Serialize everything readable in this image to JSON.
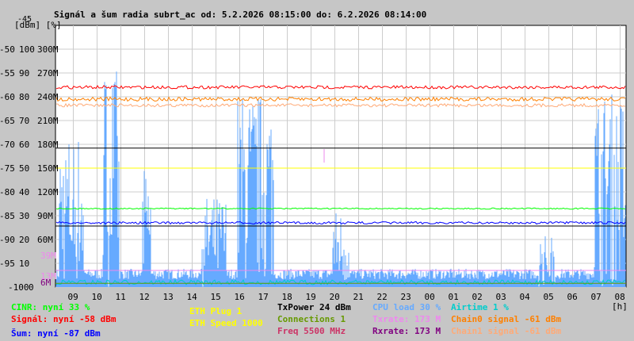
{
  "chart_data": {
    "type": "line",
    "title": "Signál a šum radia subrt_ac od: 5.2.2026 08:15:00 do: 6.2.2026 08:14:00",
    "y_units": "[dBm] [%]",
    "y_top_label": "-45",
    "ylim": [
      -100,
      -45
    ],
    "yticks": [
      {
        "dbm": "-50",
        "pct": "100",
        "rate": "300M"
      },
      {
        "dbm": "-55",
        "pct": "90",
        "rate": "270M"
      },
      {
        "dbm": "-60",
        "pct": "80",
        "rate": "240M"
      },
      {
        "dbm": "-65",
        "pct": "70",
        "rate": "210M"
      },
      {
        "dbm": "-70",
        "pct": "60",
        "rate": "180M"
      },
      {
        "dbm": "-75",
        "pct": "50",
        "rate": "150M"
      },
      {
        "dbm": "-80",
        "pct": "40",
        "rate": "120M"
      },
      {
        "dbm": "-85",
        "pct": "30",
        "rate": "90M"
      },
      {
        "dbm": "-90",
        "pct": "20",
        "rate": "60M"
      },
      {
        "dbm": "-95",
        "pct": "10",
        "rate": ""
      },
      {
        "dbm": "-100",
        "pct": "0",
        "rate": ""
      }
    ],
    "extra_labels": {
      "a": "39M",
      "b": "13M",
      "c": "6M"
    },
    "xticks": [
      "09",
      "10",
      "11",
      "12",
      "13",
      "14",
      "15",
      "16",
      "17",
      "18",
      "19",
      "20",
      "21",
      "22",
      "23",
      "00",
      "01",
      "02",
      "03",
      "04",
      "05",
      "06",
      "07",
      "08"
    ],
    "x_unit": "[h]",
    "series": [
      {
        "name": "Signál",
        "color": "#ff0000",
        "level_dbm": -58
      },
      {
        "name": "Chain0 signal",
        "color": "#ff8000",
        "level_dbm": -61
      },
      {
        "name": "Chain1 signal",
        "color": "#ffaa77",
        "level_dbm": -61
      },
      {
        "name": "Rxrate",
        "color": "#800080",
        "level_dbm": -70.8
      },
      {
        "name": "ETH Speed",
        "color": "#ffff00",
        "level_dbm": -75
      },
      {
        "name": "CINR",
        "color": "#00ff00",
        "level_dbm": -83.5
      },
      {
        "name": "Šum",
        "color": "#0000ff",
        "level_dbm": -86.5
      },
      {
        "name": "CPU load",
        "color": "#66aaff",
        "level_pct": [
          0,
          40
        ]
      },
      {
        "name": "Airtime",
        "color": "#00cccc",
        "level_pct": [
          0,
          5
        ]
      }
    ]
  },
  "legend": {
    "cinr": "CINR: nyní 33 %",
    "signal": "Signál: nyní -58 dBm",
    "noise": "Šum: nyní -87 dBm",
    "eth_plug": "ETH Plug 1",
    "eth_speed": "ETH Speed 1000",
    "txpower": "TxPower 24 dBm",
    "connections": "Connections 1",
    "freq": "Freq 5500 MHz",
    "cpu": "CPU load 30 %",
    "txrate": "Txrate: 173 M",
    "rxrate": "Rxrate: 173 M",
    "airtime": "Airtime 1 %",
    "chain0": "Chain0 signal -61 dBm",
    "chain1": "Chain1 signal -61 dBm"
  },
  "colors": {
    "cinr": "#00ff00",
    "signal": "#ff0000",
    "noise": "#0000ff",
    "eth": "#ffff00",
    "tx": "#000000",
    "conn": "#669900",
    "freq": "#cc3366",
    "cpu": "#66aaff",
    "txrate": "#ee88ee",
    "rxrate": "#800080",
    "airtime": "#00cccc",
    "chain0": "#ff8000",
    "chain1": "#ffaa77"
  }
}
